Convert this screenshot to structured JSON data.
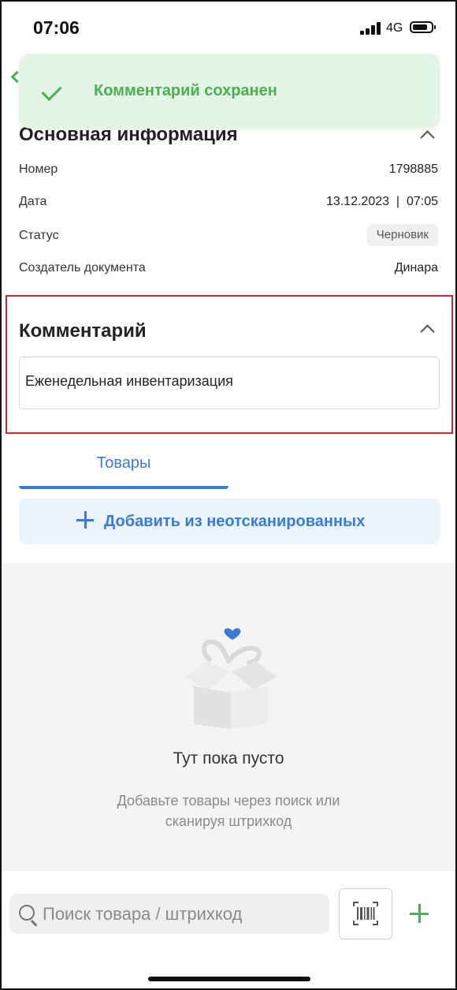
{
  "status_bar": {
    "time": "07:06",
    "network": "4G"
  },
  "toast": {
    "message": "Комментарий сохранен"
  },
  "basic_info": {
    "title": "Основная информация",
    "rows": [
      {
        "label": "Номер",
        "value": "1798885"
      },
      {
        "label": "Дата",
        "value": "13.12.2023  |  07:05"
      },
      {
        "label": "Статус",
        "value": "Черновик"
      },
      {
        "label": "Создатель документа",
        "value": "Динара"
      }
    ]
  },
  "comment": {
    "title": "Комментарий",
    "value": "Еженедельная инвентаризация"
  },
  "tabs": [
    {
      "label": "Товары",
      "active": true
    }
  ],
  "add_button": {
    "label": "Добавить из неотсканированных"
  },
  "empty_state": {
    "title": "Тут пока пусто",
    "hint": "Добавьте товары через поиск или сканируя штрихкод"
  },
  "search": {
    "placeholder": "Поиск товара / штрихкод"
  },
  "icons": {
    "toast": "check-icon",
    "collapse": "chevron-up-icon",
    "add": "plus-icon",
    "empty": "gift-box-icon",
    "search": "search-icon",
    "scan": "barcode-scan-icon",
    "create": "plus-icon"
  },
  "colors": {
    "accent": "#3a7bd5",
    "success": "#4caf50",
    "toast_bg": "#e3f5e6",
    "highlight": "#d9232e"
  }
}
